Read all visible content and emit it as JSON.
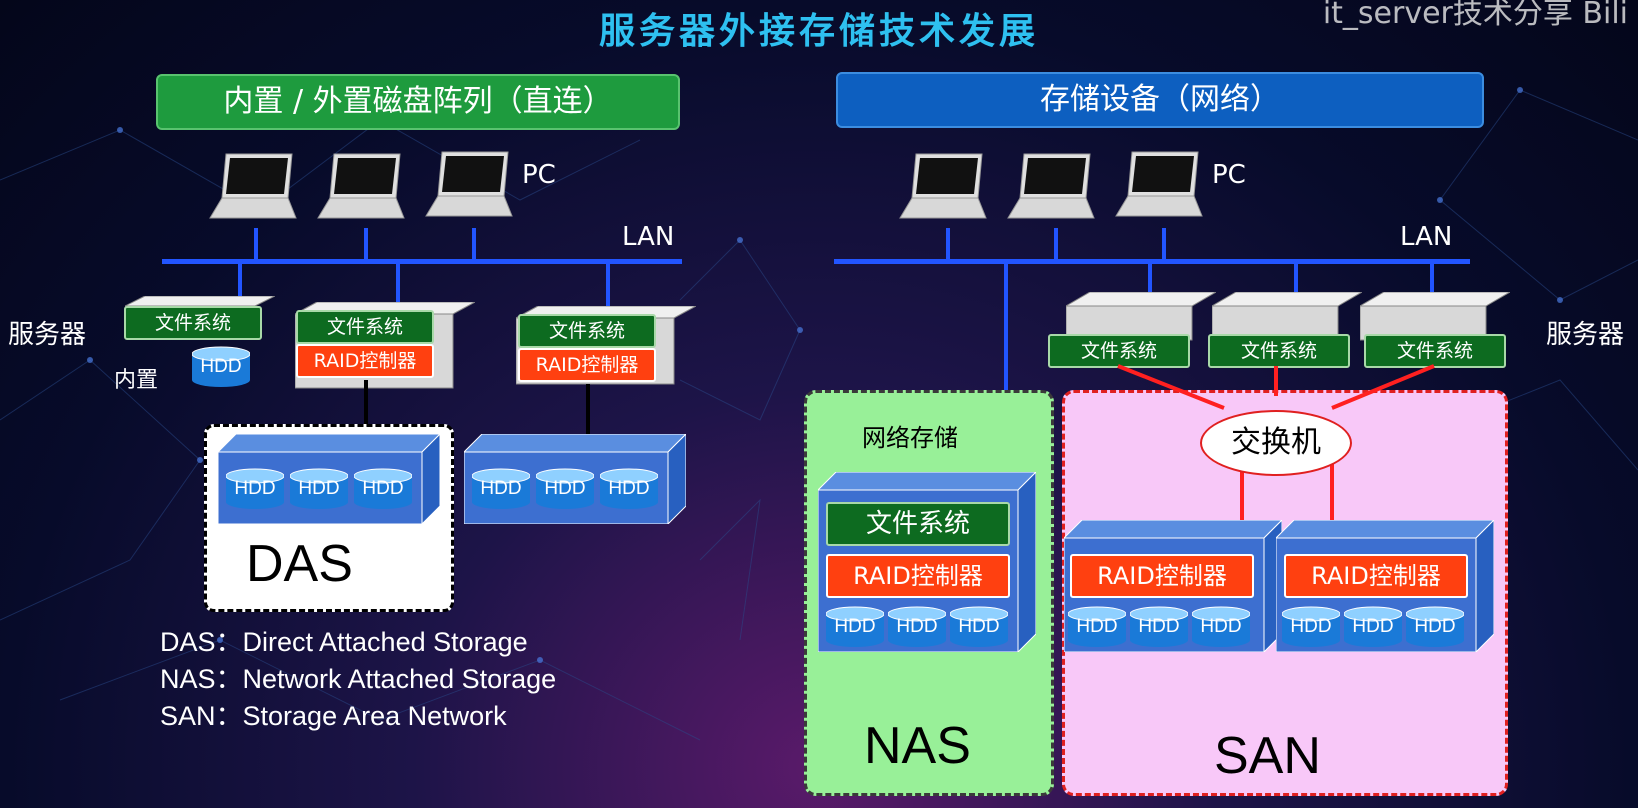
{
  "title": "服务器外接存储技术发展",
  "watermark": "it_server技术分享 Bili",
  "left": {
    "header": "内置 / 外置磁盘阵列（直连）",
    "pc_label": "PC",
    "lan_label": "LAN",
    "server_label": "服务器",
    "builtin_label": "内置",
    "fs_label": "文件系统",
    "raid_label": "RAID控制器",
    "hdd_label": "HDD",
    "das_label": "DAS"
  },
  "right": {
    "header": "存储设备（网络）",
    "pc_label": "PC",
    "lan_label": "LAN",
    "server_label": "服务器",
    "fs_label": "文件系统",
    "network_storage_label": "网络存储",
    "switch_label": "交换机",
    "raid_label": "RAID控制器",
    "hdd_label": "HDD",
    "nas_label": "NAS",
    "san_label": "SAN"
  },
  "legend": [
    "DAS：Direct Attached Storage",
    "NAS：Network Attached Storage",
    "SAN：Storage Area Network"
  ],
  "colors": {
    "title": "#2ec0f0",
    "lan": "#2255ff",
    "fs_bg": "#0d6b20",
    "raid_bg": "#ff4010",
    "nas_bg": "#98f098",
    "san_bg": "#f8c8f8",
    "san_border": "#e02020"
  }
}
